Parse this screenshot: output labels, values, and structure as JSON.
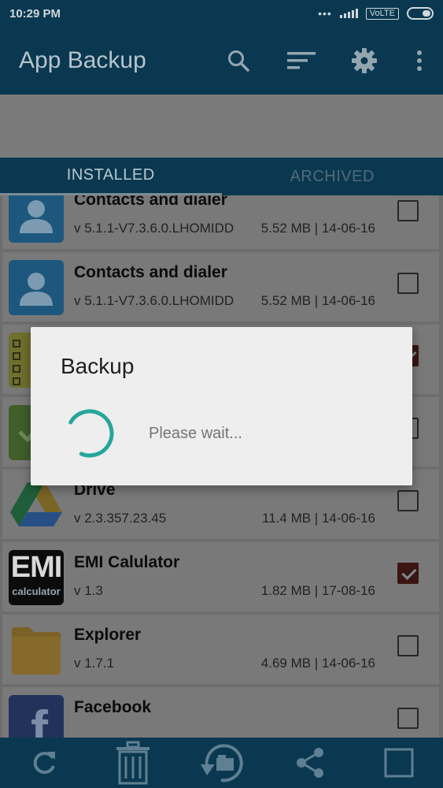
{
  "status_bar": {
    "time": "10:29 PM",
    "network": "VoLTE"
  },
  "app_bar": {
    "title": "App Backup",
    "actions": [
      "search-icon",
      "sort-icon",
      "gear-icon",
      "more-vert-icon"
    ]
  },
  "tabs": [
    {
      "label": "INSTALLED",
      "active": true
    },
    {
      "label": "ARCHIVED",
      "active": false
    }
  ],
  "apps": [
    {
      "name": "Contacts and dialer",
      "version": "v 5.1.1-V7.3.6.0.LHOMIDD",
      "meta": "5.52 MB | 14-06-16",
      "checked": false,
      "icon": "contacts-icon"
    },
    {
      "name": "Contacts and dialer",
      "version": "v 5.1.1-V7.3.6.0.LHOMIDD",
      "meta": "5.52 MB | 14-06-16",
      "checked": false,
      "icon": "contacts-icon"
    },
    {
      "name": "",
      "version": "",
      "meta": "",
      "checked": true,
      "icon": "notes-icon"
    },
    {
      "name": "",
      "version": "",
      "meta": "",
      "checked": false,
      "icon": "app-icon"
    },
    {
      "name": "Drive",
      "version": "v 2.3.357.23.45",
      "meta": "11.4 MB | 14-06-16",
      "checked": false,
      "icon": "drive-icon"
    },
    {
      "name": "EMI Calulator",
      "version": "v 1.3",
      "meta": "1.82 MB | 17-08-16",
      "checked": true,
      "icon": "emi-calculator-icon"
    },
    {
      "name": "Explorer",
      "version": "v 1.7.1",
      "meta": "4.69 MB | 14-06-16",
      "checked": false,
      "icon": "folder-icon"
    },
    {
      "name": "Facebook",
      "version": "",
      "meta": "",
      "checked": false,
      "icon": "facebook-icon"
    }
  ],
  "emi_icon_text": {
    "big": "EMI",
    "small": "calculator"
  },
  "facebook_letter": "f",
  "dialog": {
    "title": "Backup",
    "message": "Please wait..."
  },
  "bottom_bar": [
    "refresh-icon",
    "trash-icon",
    "restore-icon",
    "share-icon",
    "select-all-icon"
  ],
  "colors": {
    "primary": "#0a3850",
    "accent": "#26a69a",
    "checked": "#8b1a1a"
  }
}
